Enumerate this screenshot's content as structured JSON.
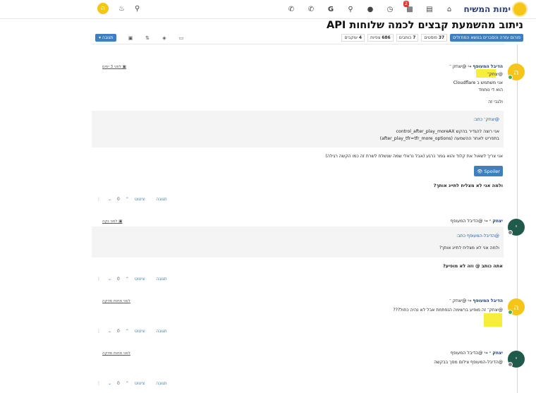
{
  "header": {
    "logo_text": "ימות המשיח",
    "avatar_letter": "ה",
    "notification_count": "2",
    "nav_icons": [
      "home-icon",
      "menu-icon",
      "comments-icon",
      "history-icon",
      "user-icon",
      "search-icon",
      "google-icon",
      "phone-icon",
      "phone-icon-2"
    ],
    "left_icons": [
      "bell-icon",
      "search-icon"
    ]
  },
  "topic": {
    "title": "ניתוב מהשמעת קבצים לכמה שלוחות API",
    "category": "פורום עזרה והסברים בנושא המודולים",
    "stats": [
      {
        "value": "37",
        "label": "פוסטים"
      },
      {
        "value": "7",
        "label": "כותבים"
      },
      {
        "value": "686",
        "label": "צפיות"
      },
      {
        "value": "4",
        "label": "עוקבים"
      }
    ],
    "reply_button": "תגובה"
  },
  "posts": [
    {
      "author": "הדיבל המעופף",
      "reply_to": "@יצחק ־",
      "time": "לפני 3 ימים",
      "avatar": "ה",
      "lines": [
        "@יצחק־",
        "אני משתמש ב Cloudflare",
        "הוא די נוחמד",
        "ולגבי זה"
      ],
      "quote_author": "@יצחק־ כתב:",
      "quote_lines": [
        "אני רוצה להגדיר בהקש control_after_play_moreAX",
        "בתפריט לאחר ההשמעה (after_play_tfr=tfr_more_options)"
      ],
      "after_quote": "אני צריך לשאול את קלוד והוא גומר כרגע (אבל נראלי שמה שנשלח לשרת זה כמו הקשה רגילה)",
      "spoiler": "Spoiler",
      "bottom_line": "ולמה אני לא מצליח לתייג אותך?",
      "actions": {
        "reply": "תגובה",
        "quote": "ציטוט",
        "votes": "0"
      }
    },
    {
      "author": "יצחק ־",
      "reply_to": "@הדיבל המעופף",
      "time": "לפני נקה",
      "avatar": "י",
      "quote_author": "@הדיבל-המעופף כתב:",
      "quote_lines": [
        "ולמה אני לא מצליח לתייג אותך?"
      ],
      "bottom_line": "אתה כותב @ וזה לא מופיע?",
      "actions": {
        "reply": "תגובה",
        "quote": "ציטוט",
        "votes": "0"
      }
    },
    {
      "author": "הדיבל המעופף",
      "reply_to": "@יצחק ־",
      "time": "לפני פחות מדקה",
      "avatar": "ה",
      "lines": [
        "@יצחק־ זה מופיע ברשימה הנפתחת אבל לא נהיה כחול???"
      ],
      "actions": {
        "reply": "תגובה",
        "quote": "ציטוט",
        "votes": "0"
      }
    },
    {
      "author": "יצחק ־",
      "reply_to": "@הדיבל המעופף",
      "time": "לפני פחות מדקה",
      "avatar": "י",
      "lines": [
        "@הדיבל-המעופף צילום מסך בבקשה"
      ],
      "actions": {
        "reply": "תגובה",
        "quote": "ציטוט",
        "votes": "0"
      }
    }
  ]
}
